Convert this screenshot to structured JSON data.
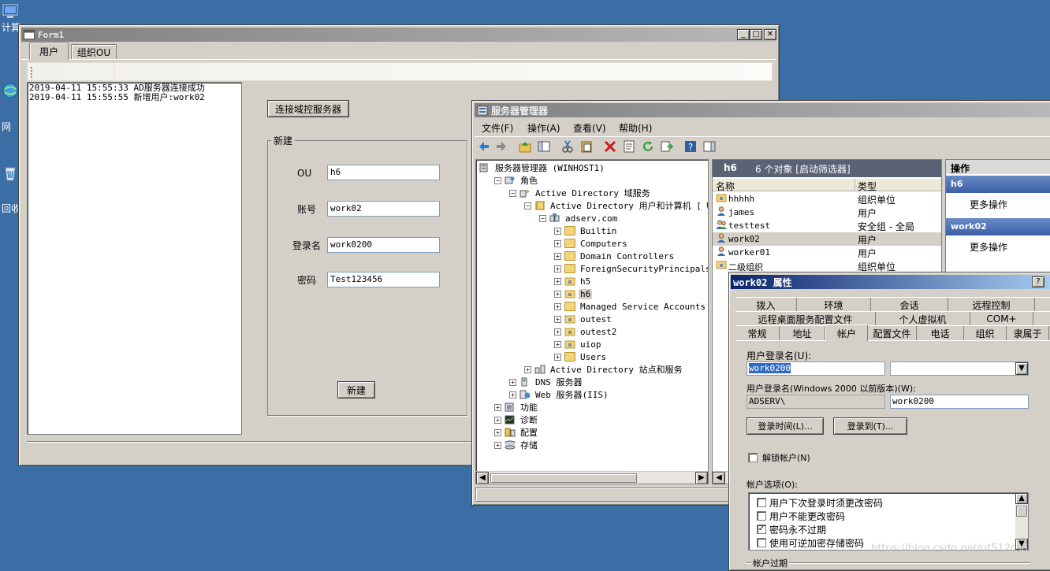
{
  "desktop": {
    "icons": [
      {
        "caption": "计算"
      },
      {
        "caption": "网"
      },
      {
        "caption": "回收"
      }
    ]
  },
  "form1": {
    "title": "Form1",
    "tabs": [
      "用户",
      "组织OU"
    ],
    "log": [
      "2019-04-11 15:55:33 AD服务器连接成功",
      "2019-04-11 15:55:55 新增用户:work02"
    ],
    "connect_button": "连接域控服务器",
    "group_label": "新建",
    "fields": {
      "ou": {
        "label": "OU",
        "value": "h6"
      },
      "account": {
        "label": "账号",
        "value": "work02"
      },
      "login": {
        "label": "登录名",
        "value": "work0200"
      },
      "password": {
        "label": "密码",
        "value": "Test123456"
      }
    },
    "create_button": "新建"
  },
  "srvmgr": {
    "title": "服务器管理器",
    "menu": [
      "文件(F)",
      "操作(A)",
      "查看(V)",
      "帮助(H)"
    ],
    "tree": [
      {
        "label": "服务器管理器 (WINHOST1)",
        "indent": 0,
        "exp": "",
        "icon": "server"
      },
      {
        "label": "角色",
        "indent": 1,
        "exp": "−",
        "icon": "roles"
      },
      {
        "label": "Active Directory 域服务",
        "indent": 2,
        "exp": "−",
        "icon": "ad"
      },
      {
        "label": "Active Directory 用户和计算机 [ WIN",
        "indent": 3,
        "exp": "−",
        "icon": "book"
      },
      {
        "label": "adserv.com",
        "indent": 4,
        "exp": "−",
        "icon": "domain"
      },
      {
        "label": "Builtin",
        "indent": 5,
        "exp": "+",
        "icon": "folder"
      },
      {
        "label": "Computers",
        "indent": 5,
        "exp": "+",
        "icon": "folder"
      },
      {
        "label": "Domain Controllers",
        "indent": 5,
        "exp": "+",
        "icon": "folder"
      },
      {
        "label": "ForeignSecurityPrincipals",
        "indent": 5,
        "exp": "+",
        "icon": "folder"
      },
      {
        "label": "h5",
        "indent": 5,
        "exp": "+",
        "icon": "ou"
      },
      {
        "label": "h6",
        "indent": 5,
        "exp": "+",
        "icon": "ou",
        "selected": true
      },
      {
        "label": "Managed Service Accounts",
        "indent": 5,
        "exp": "+",
        "icon": "folder"
      },
      {
        "label": "outest",
        "indent": 5,
        "exp": "+",
        "icon": "ou"
      },
      {
        "label": "outest2",
        "indent": 5,
        "exp": "+",
        "icon": "ou"
      },
      {
        "label": "uiop",
        "indent": 5,
        "exp": "+",
        "icon": "ou"
      },
      {
        "label": "Users",
        "indent": 5,
        "exp": "+",
        "icon": "folder"
      },
      {
        "label": "Active Directory 站点和服务",
        "indent": 3,
        "exp": "+",
        "icon": "sites"
      },
      {
        "label": "DNS 服务器",
        "indent": 2,
        "exp": "+",
        "icon": "dns"
      },
      {
        "label": "Web 服务器(IIS)",
        "indent": 2,
        "exp": "+",
        "icon": "web"
      },
      {
        "label": "功能",
        "indent": 1,
        "exp": "+",
        "icon": "features"
      },
      {
        "label": "诊断",
        "indent": 1,
        "exp": "+",
        "icon": "diag"
      },
      {
        "label": "配置",
        "indent": 1,
        "exp": "+",
        "icon": "config"
      },
      {
        "label": "存储",
        "indent": 1,
        "exp": "+",
        "icon": "storage"
      }
    ],
    "list_header": {
      "name": "h6",
      "count": "6 个对象  [启动筛选器]"
    },
    "columns": [
      "名称",
      "类型"
    ],
    "rows": [
      {
        "name": "hhhhh",
        "type": "组织单位",
        "icon": "ou"
      },
      {
        "name": "james",
        "type": "用户",
        "icon": "user"
      },
      {
        "name": "testtest",
        "type": "安全组 - 全局",
        "icon": "group"
      },
      {
        "name": "work02",
        "type": "用户",
        "icon": "user",
        "selected": true
      },
      {
        "name": "worker01",
        "type": "用户",
        "icon": "user"
      },
      {
        "name": "二级组织",
        "type": "组织单位",
        "icon": "ou"
      }
    ],
    "actions": {
      "title": "操作",
      "section1": "h6",
      "more1": "更多操作",
      "section2": "work02",
      "more2": "更多操作"
    }
  },
  "props": {
    "title": "work02 属性",
    "help": "?",
    "tabs_row1": [
      "拨入",
      "环境",
      "会话",
      "远程控制"
    ],
    "tabs_row2": [
      "远程桌面服务配置文件",
      "个人虚拟机",
      "COM+"
    ],
    "tabs_row3": [
      "常规",
      "地址",
      "帐户",
      "配置文件",
      "电话",
      "组织",
      "隶属于"
    ],
    "logon_name_label": "用户登录名(U):",
    "logon_name_value": "work0200",
    "logon_name_pre2000_label": "用户登录名(Windows 2000 以前版本)(W):",
    "domain_prefix": "ADSERV\\",
    "pre2000_value": "work0200",
    "logon_hours_button": "登录时间(L)...",
    "logon_to_button": "登录到(T)...",
    "unlock_label": "解锁帐户(N)",
    "options_label": "帐户选项(O):",
    "options": [
      {
        "label": "用户下次登录时须更改密码",
        "checked": false
      },
      {
        "label": "用户不能更改密码",
        "checked": false
      },
      {
        "label": "密码永不过期",
        "checked": true
      },
      {
        "label": "使用可逆加密存储密码",
        "checked": false
      }
    ],
    "expires_label": "帐户过期"
  },
  "watermark": "https://blog.csdn.net/ot512csdn"
}
